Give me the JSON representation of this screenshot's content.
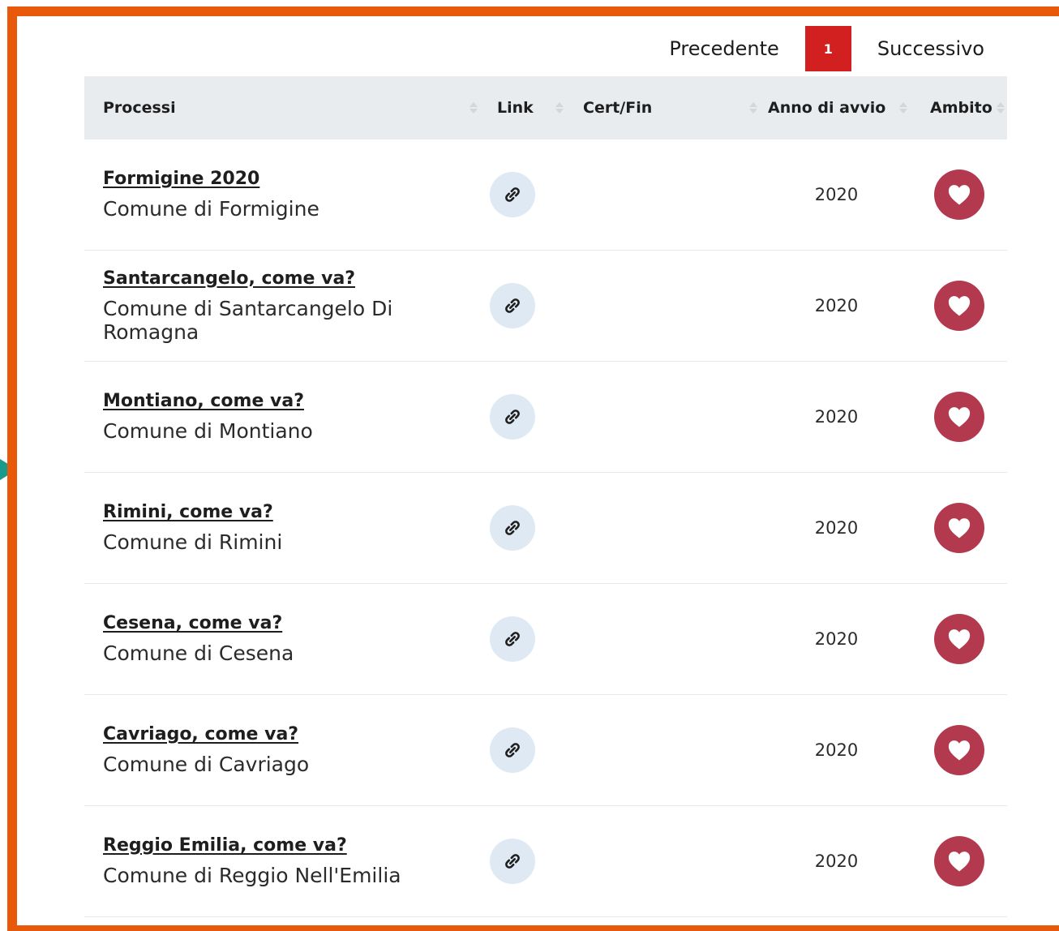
{
  "pagination": {
    "prev_label": "Precedente",
    "current_page": "1",
    "next_label": "Successivo"
  },
  "table": {
    "columns": [
      "Processi",
      "Link",
      "Cert/Fin",
      "Anno di avvio",
      "Ambito"
    ],
    "rows": [
      {
        "title": "Formigine 2020",
        "entity": "Comune di Formigine",
        "cert_fin": "",
        "year": "2020",
        "ambito_icon": "heart-icon"
      },
      {
        "title": "Santarcangelo, come va?",
        "entity": "Comune di Santarcangelo Di Romagna",
        "cert_fin": "",
        "year": "2020",
        "ambito_icon": "heart-icon"
      },
      {
        "title": "Montiano, come va?",
        "entity": "Comune di Montiano",
        "cert_fin": "",
        "year": "2020",
        "ambito_icon": "heart-icon"
      },
      {
        "title": "Rimini, come va?",
        "entity": "Comune di Rimini",
        "cert_fin": "",
        "year": "2020",
        "ambito_icon": "heart-icon"
      },
      {
        "title": "Cesena, come va?",
        "entity": "Comune di Cesena",
        "cert_fin": "",
        "year": "2020",
        "ambito_icon": "heart-icon"
      },
      {
        "title": "Cavriago, come va?",
        "entity": "Comune di Cavriago",
        "cert_fin": "",
        "year": "2020",
        "ambito_icon": "heart-icon"
      },
      {
        "title": "Reggio Emilia, come va?",
        "entity": "Comune di Reggio Nell'Emilia",
        "cert_fin": "",
        "year": "2020",
        "ambito_icon": "heart-icon"
      }
    ]
  },
  "colors": {
    "frame_border": "#e8590c",
    "current_page_bg": "#d21f1f",
    "heart_bg": "#b33a4e",
    "link_bg": "#dfe9f3",
    "header_bg": "#e8ecef"
  }
}
